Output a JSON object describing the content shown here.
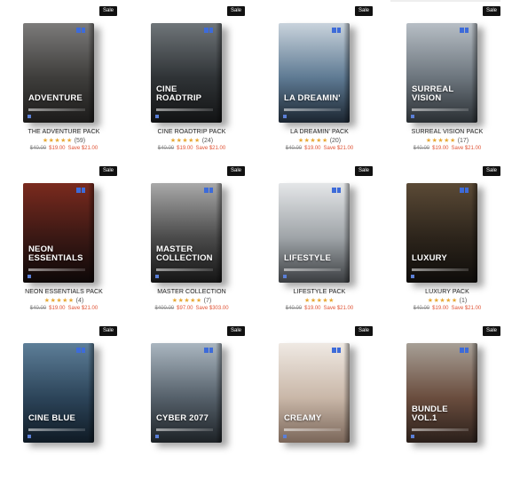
{
  "products": [
    {
      "name": "THE ADVENTURE PACK",
      "box_title": "ADVENTURE",
      "stars": "★★★★★",
      "reviews": "(59)",
      "old_price": "$40.00",
      "new_price": "$19.00",
      "save": "Save $21.00",
      "sale": "Sale",
      "colors": [
        "#7c7b7a",
        "#3e3d3b",
        "#1c1b1a"
      ]
    },
    {
      "name": "CINE ROADTRIP PACK",
      "box_title": "CINE ROADTRIP",
      "stars": "★★★★★",
      "reviews": "(24)",
      "old_price": "$40.00",
      "new_price": "$19.00",
      "save": "Save $21.00",
      "sale": "Sale",
      "colors": [
        "#6f7579",
        "#2f3336",
        "#121314"
      ]
    },
    {
      "name": "LA DREAMIN' PACK",
      "box_title": "LA DREAMIN'",
      "stars": "★★★★★",
      "reviews": "(20)",
      "old_price": "$40.00",
      "new_price": "$19.00",
      "save": "Save $21.00",
      "sale": "Sale",
      "colors": [
        "#c9d3dc",
        "#5e7a93",
        "#1b2530"
      ]
    },
    {
      "name": "SURREAL VISION PACK",
      "box_title": "SURREAL VISION",
      "stars": "★★★★★",
      "reviews": "(17)",
      "old_price": "$40.00",
      "new_price": "$19.00",
      "save": "Save $21.00",
      "sale": "Sale",
      "colors": [
        "#b7bec5",
        "#6c757d",
        "#2a2f33"
      ]
    },
    {
      "name": "NEON ESSENTIALS PACK",
      "box_title": "NEON ESSENTIALS",
      "stars": "★★★★★",
      "reviews": "(4)",
      "old_price": "$40.00",
      "new_price": "$19.00",
      "save": "Save $21.00",
      "sale": "Sale",
      "colors": [
        "#7a2a1e",
        "#3a1814",
        "#0d0808"
      ]
    },
    {
      "name": "MASTER COLLECTION",
      "box_title": "MASTER COLLECTION",
      "stars": "★★★★★",
      "reviews": "(7)",
      "old_price": "$400.00",
      "new_price": "$97.00",
      "save": "Save $303.00",
      "sale": "Sale",
      "colors": [
        "#a9a9a9",
        "#4a4a4a",
        "#151515"
      ]
    },
    {
      "name": "LIFESTYLE PACK",
      "box_title": "LIFESTYLE",
      "stars": "★★★★★",
      "reviews": "",
      "old_price": "$40.00",
      "new_price": "$19.00",
      "save": "Save $21.00",
      "sale": "Sale",
      "colors": [
        "#e4e6e8",
        "#9fa4a8",
        "#3a3d40"
      ]
    },
    {
      "name": "LUXURY PACK",
      "box_title": "LUXURY",
      "stars": "★★★★★",
      "reviews": "(1)",
      "old_price": "$40.00",
      "new_price": "$19.00",
      "save": "Save $21.00",
      "sale": "Sale",
      "colors": [
        "#5b4a36",
        "#2c241b",
        "#0e0c0a"
      ]
    },
    {
      "name": "",
      "box_title": "CINE BLUE",
      "stars": "",
      "reviews": "",
      "old_price": "",
      "new_price": "",
      "save": "",
      "sale": "Sale",
      "colors": [
        "#5d7e98",
        "#2c4459",
        "#0f1a24"
      ]
    },
    {
      "name": "",
      "box_title": "CYBER 2077",
      "stars": "",
      "reviews": "",
      "old_price": "",
      "new_price": "",
      "save": "",
      "sale": "Sale",
      "colors": [
        "#aab6c0",
        "#55606a",
        "#1d2226"
      ]
    },
    {
      "name": "",
      "box_title": "CREAMY",
      "stars": "",
      "reviews": "",
      "old_price": "",
      "new_price": "",
      "save": "",
      "sale": "Sale",
      "colors": [
        "#efe9e3",
        "#c9b7a8",
        "#7a6659"
      ]
    },
    {
      "name": "",
      "box_title": "BUNDLE VOL.1",
      "stars": "",
      "reviews": "",
      "old_price": "",
      "new_price": "",
      "save": "",
      "sale": "Sale",
      "colors": [
        "#a79f96",
        "#6a4d3e",
        "#2a1f1a"
      ]
    }
  ]
}
